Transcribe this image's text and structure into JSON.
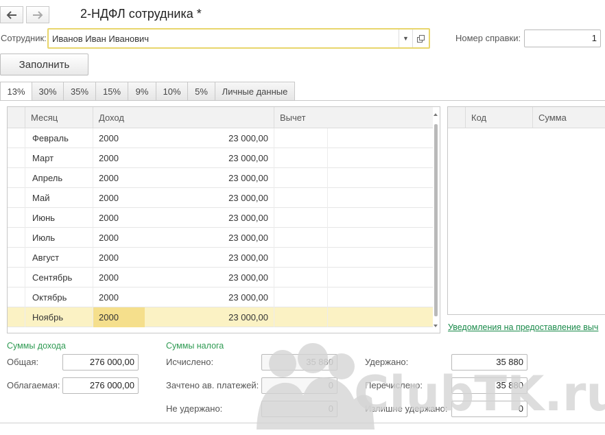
{
  "window": {
    "title": "2-НДФЛ сотрудника *"
  },
  "nav": {
    "back_icon": "arrow-left-icon",
    "forward_icon": "arrow-right-icon"
  },
  "employee": {
    "label": "Сотрудник:",
    "value": "Иванов Иван Иванович"
  },
  "cert_number": {
    "label": "Номер справки:",
    "value": "1"
  },
  "toolbar": {
    "fill_label": "Заполнить"
  },
  "tabs": [
    {
      "label": "13%",
      "active": true
    },
    {
      "label": "30%"
    },
    {
      "label": "35%"
    },
    {
      "label": "15%"
    },
    {
      "label": "9%"
    },
    {
      "label": "10%"
    },
    {
      "label": "5%"
    },
    {
      "label": "Личные данные"
    }
  ],
  "income_table": {
    "columns": [
      "Месяц",
      "Доход",
      "Вычет"
    ],
    "rows": [
      {
        "month": "Февраль",
        "code": "2000",
        "amount": "23 000,00"
      },
      {
        "month": "Март",
        "code": "2000",
        "amount": "23 000,00"
      },
      {
        "month": "Апрель",
        "code": "2000",
        "amount": "23 000,00"
      },
      {
        "month": "Май",
        "code": "2000",
        "amount": "23 000,00"
      },
      {
        "month": "Июнь",
        "code": "2000",
        "amount": "23 000,00"
      },
      {
        "month": "Июль",
        "code": "2000",
        "amount": "23 000,00"
      },
      {
        "month": "Август",
        "code": "2000",
        "amount": "23 000,00"
      },
      {
        "month": "Сентябрь",
        "code": "2000",
        "amount": "23 000,00"
      },
      {
        "month": "Октябрь",
        "code": "2000",
        "amount": "23 000,00"
      },
      {
        "month": "Ноябрь",
        "code": "2000",
        "amount": "23 000,00",
        "selected": true
      }
    ]
  },
  "deduction_table": {
    "columns": [
      "Код",
      "Сумма"
    ]
  },
  "notices_link": "Уведомления на предоставление выч",
  "income_sums": {
    "title": "Суммы дохода",
    "total_label": "Общая:",
    "total_value": "276 000,00",
    "taxable_label": "Облагаемая:",
    "taxable_value": "276 000,00"
  },
  "tax_sums": {
    "title": "Суммы налога",
    "calculated_label": "Исчислено:",
    "calculated_value": "35 880",
    "offset_label": "Зачтено ав. платежей:",
    "offset_value": "0",
    "not_withheld_label": "Не удержано:",
    "not_withheld_value": "0",
    "withheld_label": "Удержано:",
    "withheld_value": "35 880",
    "transferred_label": "Перечислено:",
    "transferred_value": "35 880",
    "excess_label": "Излишне удержано:",
    "excess_value": "0"
  },
  "watermark": "ClubTK.ru",
  "colors": {
    "section": "#2e9a52",
    "selected_row": "#fbf2c4",
    "field_focus": "#e8d56b"
  }
}
